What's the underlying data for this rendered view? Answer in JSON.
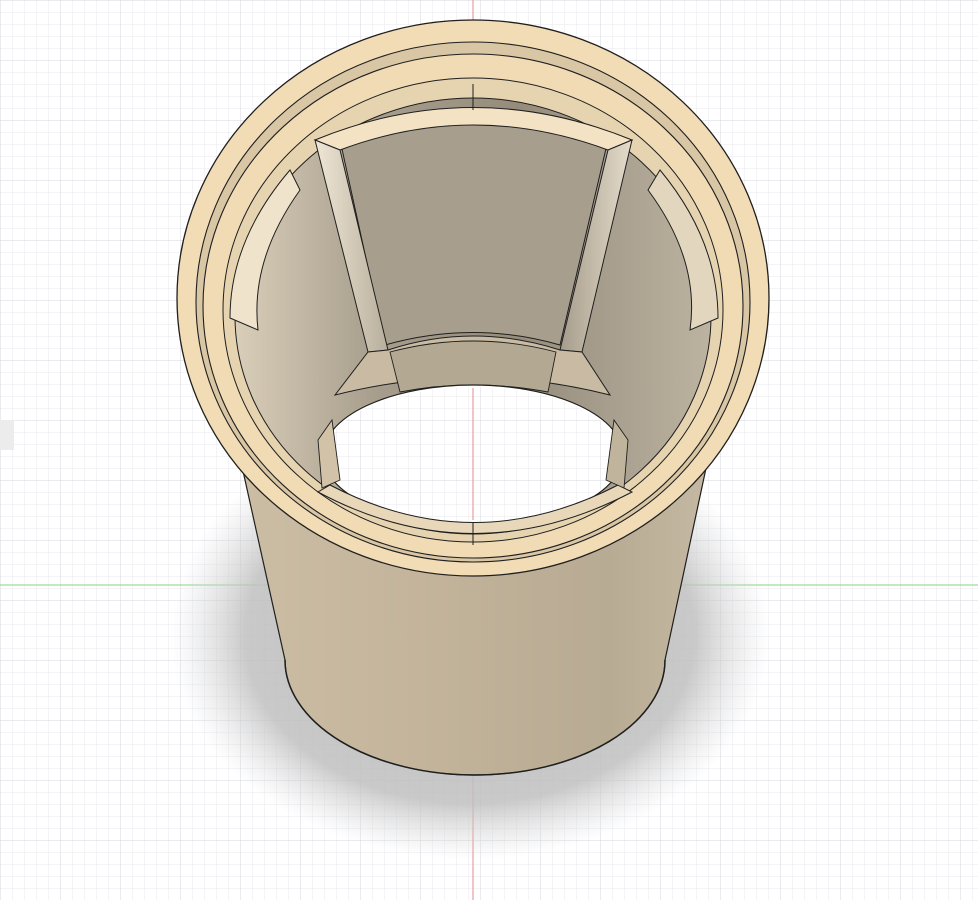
{
  "viewport": {
    "view": "3D CAD viewport",
    "background": "#ffffff",
    "grid_minor_color": "#e4e6ea",
    "grid_major_color": "#cfd3d9",
    "x_axis_color": "#8fd68f",
    "y_axis_color": "#e58a8a",
    "shadow_color": "#bdbdbd"
  },
  "model": {
    "shape": "hollow cylindrical sleeve with stepped rim and internal ribs",
    "rim_color": "#f2dcb6",
    "body_color": "#c7b9a1",
    "interior_color": "#aba190",
    "edge_color": "#1f1f1f"
  }
}
